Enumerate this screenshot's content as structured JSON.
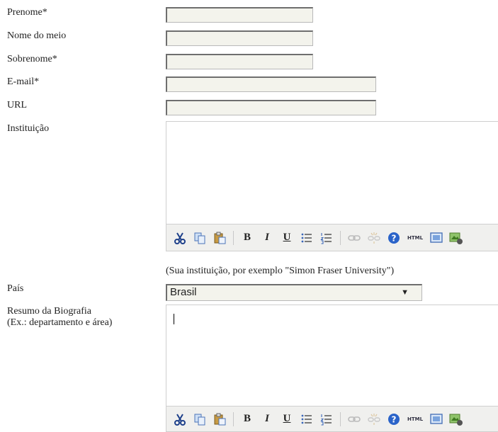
{
  "form": {
    "first_name_label": "Prenome*",
    "middle_name_label": "Nome do meio",
    "last_name_label": "Sobrenome*",
    "email_label": "E-mail*",
    "url_label": "URL",
    "institution_label": "Instituição",
    "institution_hint": "(Sua instituição, por exemplo \"Simon Fraser University\")",
    "country_label": "País",
    "country_value": "Brasil",
    "bio_label_line1": "Resumo da Biografia",
    "bio_label_line2": "(Ex.: departamento e área)"
  },
  "toolbar_icons": [
    "cut-icon",
    "copy-icon",
    "paste-icon",
    "bold-icon",
    "italic-icon",
    "underline-icon",
    "bullet-list-icon",
    "numbered-list-icon",
    "link-icon",
    "unlink-icon",
    "help-icon",
    "html-icon",
    "fullscreen-icon",
    "image-icon"
  ],
  "toolbar_text": {
    "bold": "B",
    "italic": "I",
    "underline": "U",
    "html": "HTML"
  },
  "colors": {
    "field_bg": "#f3f3ec",
    "toolbar_bg": "#f0f0ee",
    "help_blue": "#2a63c9"
  }
}
